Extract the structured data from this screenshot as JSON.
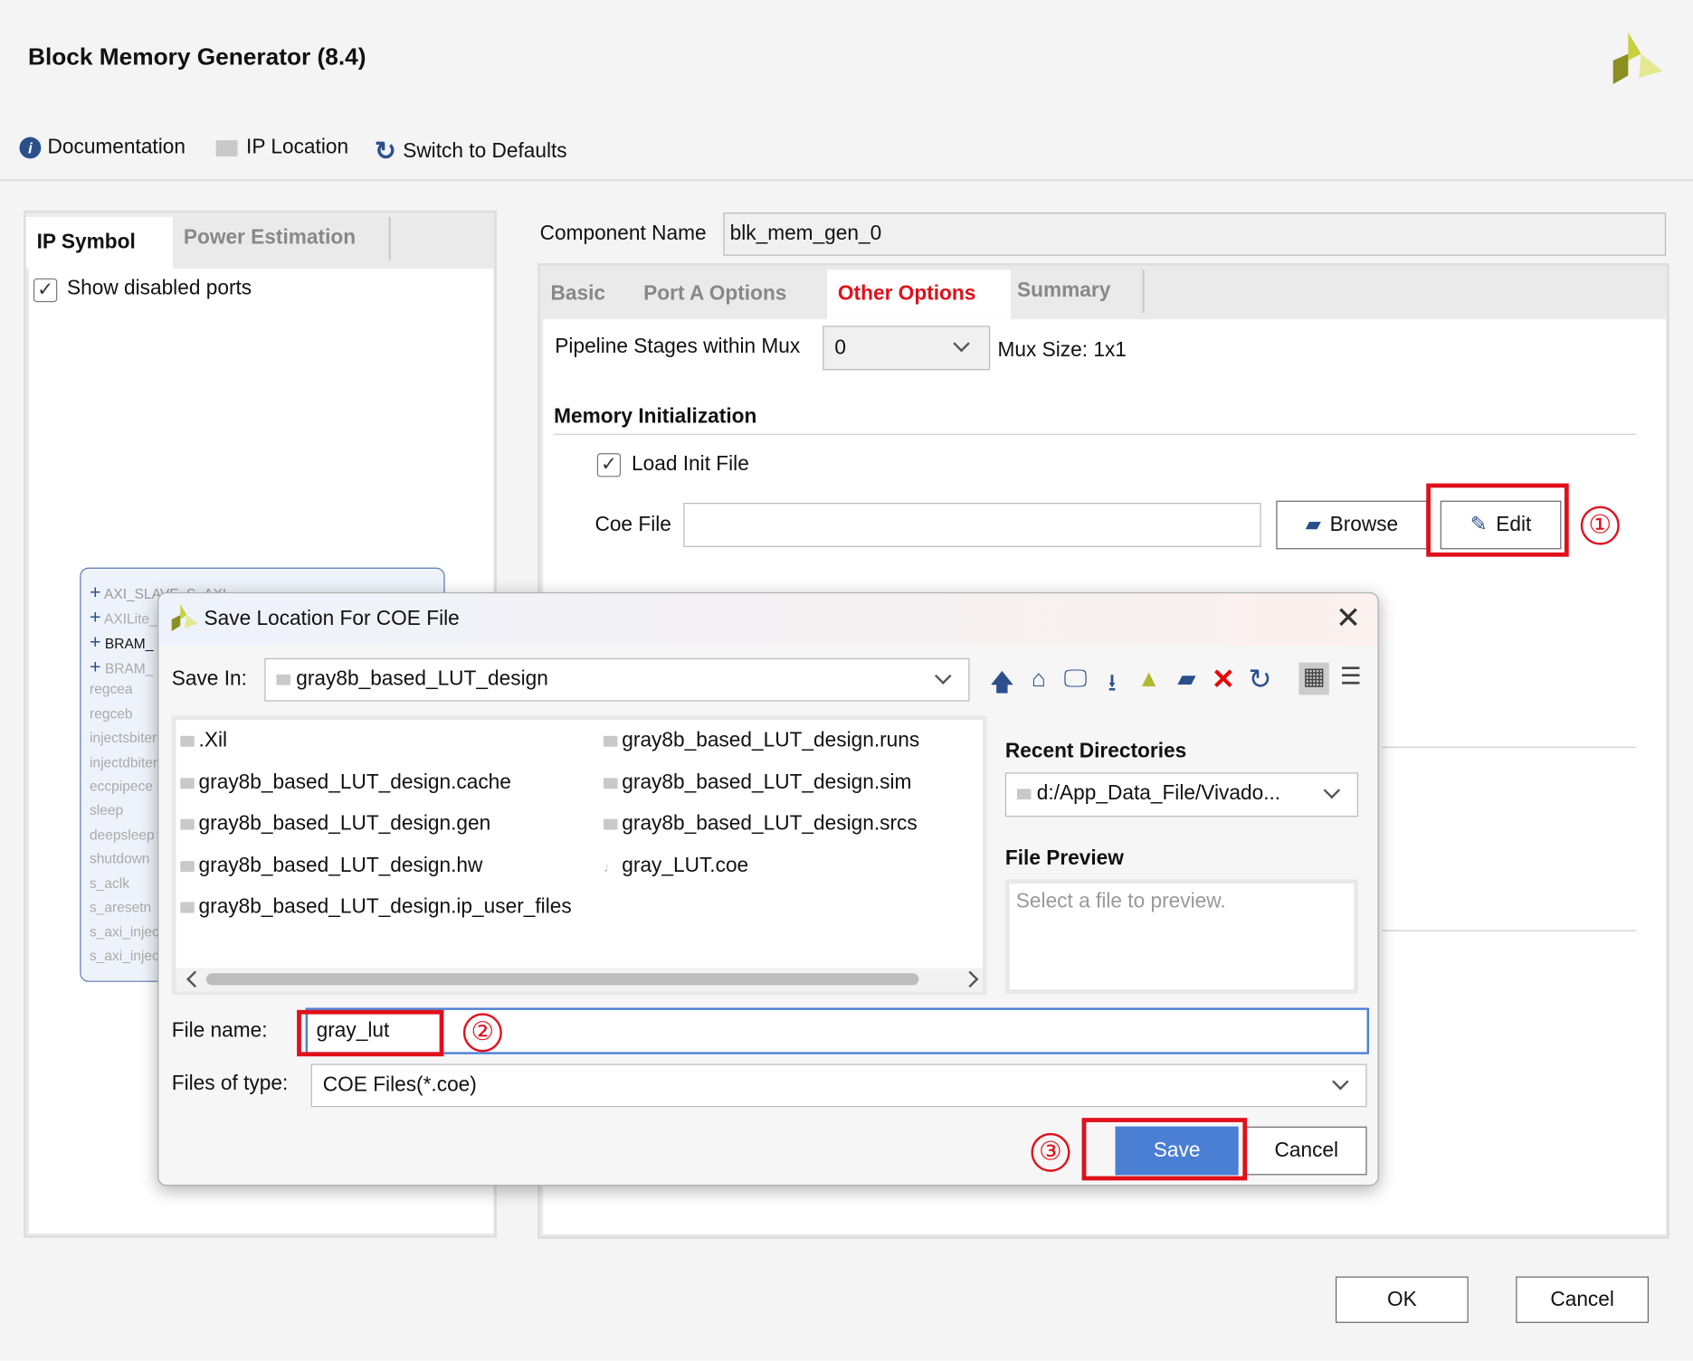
{
  "window": {
    "title": "Block Memory Generator (8.4)",
    "logo": "xilinx-logo"
  },
  "toolbar": {
    "documentation": "Documentation",
    "ip_location": "IP Location",
    "switch_defaults": "Switch to Defaults"
  },
  "left_panel": {
    "tabs": [
      "IP Symbol",
      "Power Estimation"
    ],
    "active_tab": "IP Symbol",
    "show_disabled_ports": {
      "label": "Show disabled ports",
      "checked": true
    },
    "symbol": {
      "buses": [
        "AXI_SLAVE_S_AXI",
        "AXILite_",
        "BRAM_",
        "BRAM_"
      ],
      "ports": [
        "regcea",
        "regceb",
        "injectsbiterr",
        "injectdbiterr",
        "eccpipece",
        "sleep",
        "deepsleep",
        "shutdown",
        "s_aclk",
        "s_aresetn",
        "s_axi_injec",
        "s_axi_injec"
      ]
    }
  },
  "component": {
    "label": "Component Name",
    "value": "blk_mem_gen_0"
  },
  "tabs": {
    "items": [
      "Basic",
      "Port A Options",
      "Other Options",
      "Summary"
    ],
    "active": "Other Options",
    "active_color": "#e0101a"
  },
  "options": {
    "pipeline_label": "Pipeline Stages within Mux",
    "pipeline_value": "0",
    "mux_size": "Mux Size: 1x1",
    "mem_init_heading": "Memory Initialization",
    "load_init": {
      "label": "Load Init File",
      "checked": true
    },
    "coe_label": "Coe File",
    "coe_value": "",
    "browse": "Browse",
    "edit": "Edit"
  },
  "annotations": {
    "one": "①",
    "two": "②",
    "three": "③",
    "color": "#e0101a"
  },
  "dialog": {
    "title": "Save Location For COE File",
    "save_in_label": "Save In:",
    "save_in_value": "gray8b_based_LUT_design",
    "toolbar_icons": [
      "up-folder-icon",
      "home-icon",
      "desktop-icon",
      "download-icon",
      "vivado-icon",
      "new-folder-icon",
      "delete-icon",
      "refresh-icon",
      "grid-view-icon",
      "list-view-icon"
    ],
    "files_col1": [
      ".Xil",
      "gray8b_based_LUT_design.cache",
      "gray8b_based_LUT_design.gen",
      "gray8b_based_LUT_design.hw",
      "gray8b_based_LUT_design.ip_user_files"
    ],
    "files_col2": [
      "gray8b_based_LUT_design.runs",
      "gray8b_based_LUT_design.sim",
      "gray8b_based_LUT_design.srcs",
      "gray_LUT.coe"
    ],
    "recent_label": "Recent Directories",
    "recent_value": "d:/App_Data_File/Vivado...",
    "preview_label": "File Preview",
    "preview_placeholder": "Select a file to preview.",
    "file_name_label": "File name:",
    "file_name_value": "gray_lut",
    "file_type_label": "Files of type:",
    "file_type_value": "COE Files(*.coe)",
    "save": "Save",
    "cancel": "Cancel",
    "save_color": "#4a7fd4"
  },
  "footer": {
    "ok": "OK",
    "cancel": "Cancel"
  }
}
